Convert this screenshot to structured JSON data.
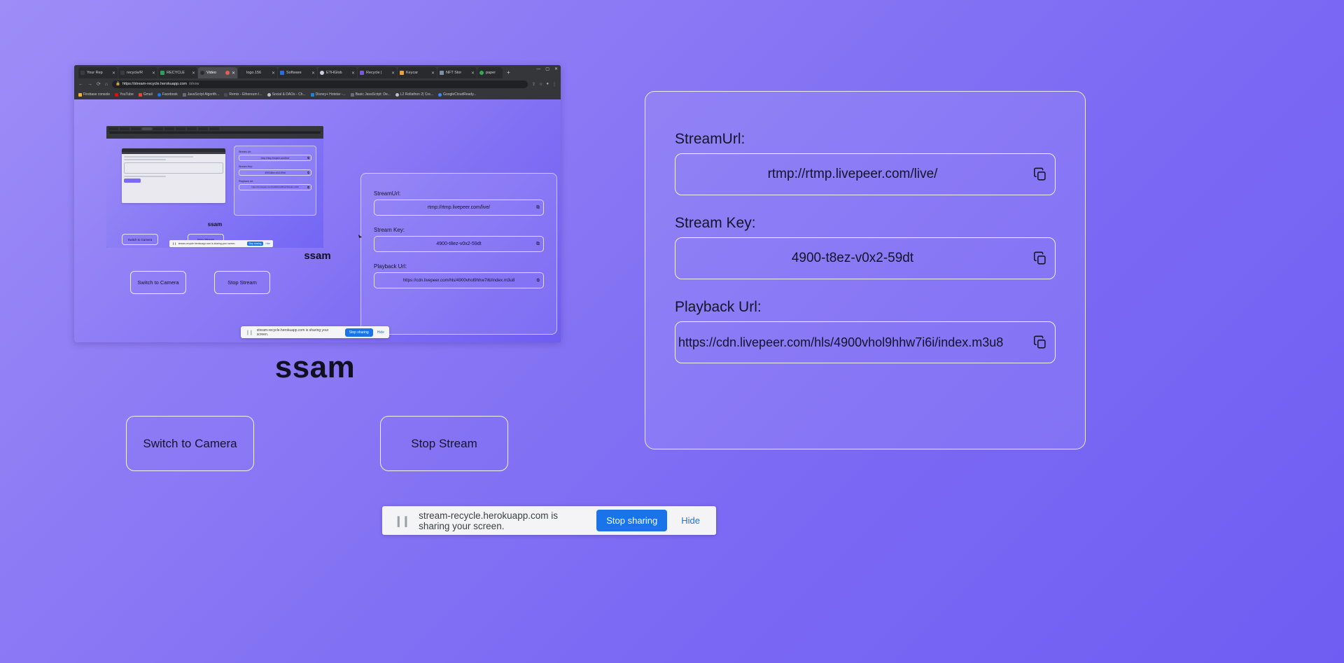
{
  "theme": {
    "background_from": "#9e8df7",
    "background_to": "#6f5df3",
    "accent_blue": "#1a73e8",
    "text_dark": "#15152a",
    "field_border": "#ffffff"
  },
  "page": {
    "title": "ssam",
    "buttons": {
      "switch_camera": "Switch to Camera",
      "stop_stream": "Stop Stream"
    }
  },
  "stream_info": {
    "stream_url_label": "StreamUrl:",
    "stream_url_value": "rtmp://rtmp.livepeer.com/live/",
    "stream_key_label": "Stream Key:",
    "stream_key_value": "4900-t8ez-v0x2-59dt",
    "playback_url_label": "Playback Url:",
    "playback_url_value": "https://cdn.livepeer.com/hls/4900vhol9hhw7i6i/index.m3u8",
    "copy_icon": "copy-icon"
  },
  "share_infobar": {
    "pause_icon": "pause-icon",
    "message": "stream-recycle.herokuapp.com is sharing your screen.",
    "stop_sharing": "Stop sharing",
    "hide": "Hide"
  },
  "screen_share_preview": {
    "browser": {
      "url_host": "https://stream-recycle.herokuapp.com",
      "url_path": "/show",
      "back_icon": "back-arrow-icon",
      "forward_icon": "forward-arrow-icon",
      "reload_icon": "reload-icon",
      "home_icon": "home-icon",
      "lock_icon": "lock-icon",
      "new_tab_icon": "plus-icon",
      "minimize_icon": "minimize-icon",
      "maximize_icon": "maximize-icon",
      "close_icon": "close-icon",
      "tabs": [
        {
          "title": "Your Rep",
          "favicon": "#3b3b44",
          "active": false
        },
        {
          "title": "recycle/R",
          "favicon": "#3b3b44",
          "active": false
        },
        {
          "title": "RECYCLE",
          "favicon": "#2f9e5c",
          "active": false
        },
        {
          "title": "Video",
          "favicon": "#2b2b33",
          "active": true
        },
        {
          "title": "logo.156",
          "favicon": "#2b2b33",
          "active": false
        },
        {
          "title": "Software",
          "favicon": "#2d6fd8",
          "active": false
        },
        {
          "title": "ETHGlob",
          "favicon": "#cfcfe0",
          "active": false
        },
        {
          "title": "Recycle |",
          "favicon": "#7a5bd6",
          "active": false
        },
        {
          "title": "Keycar",
          "favicon": "#e8a33d",
          "active": false
        },
        {
          "title": "NFT Stor",
          "favicon": "#7d8fa8",
          "active": false
        },
        {
          "title": "paper",
          "favicon": "#34a853",
          "active": false
        }
      ],
      "bookmarks": [
        {
          "label": "Firebase console",
          "favicon": "#f7b32b"
        },
        {
          "label": "YouTube",
          "favicon": "#ff0000"
        },
        {
          "label": "Gmail",
          "favicon": "#ea4335"
        },
        {
          "label": "Facebook",
          "favicon": "#1877f2"
        },
        {
          "label": "JavaScript Algorith...",
          "favicon": "#6a6a7a"
        },
        {
          "label": "Remix - Ethereum I...",
          "favicon": "#4a4a58"
        },
        {
          "label": "Social & DAOs - Ch...",
          "favicon": "#c0c0cc"
        },
        {
          "label": "Disney+ Hotstar -...",
          "favicon": "#1f80e0"
        },
        {
          "label": "Basic JavaScript: De...",
          "favicon": "#6a6a7a"
        },
        {
          "label": "L2 Rollathon 2| Cre...",
          "favicon": "#c0c0cc"
        },
        {
          "label": "GoogleCloudReady...",
          "favicon": "#4285f4"
        }
      ]
    },
    "captured_page": {
      "title": "ssam",
      "buttons": {
        "switch_camera": "Switch to Camera",
        "stop_stream": "Stop Stream"
      },
      "stream_info": {
        "stream_url_label": "StreamUrl:",
        "stream_url_value": "rtmp://rtmp.livepeer.com/live/",
        "stream_key_label": "Stream Key:",
        "stream_key_value": "4900-t8ez-v0x2-59dt",
        "playback_url_label": "Playback Url:",
        "playback_url_value": "https://cdn.livepeer.com/hls/4900vhol9hhw7i6i/index.m3u8"
      },
      "share_infobar": {
        "message": "stream-recycle.herokuapp.com is sharing your screen.",
        "stop_sharing": "Stop sharing",
        "hide": "Hide"
      },
      "nested_capture": {
        "title": "ssam",
        "buttons": {
          "switch_camera": "Switch to Camera",
          "stop_stream": "Stop Stream"
        },
        "stream_info": {
          "stream_url_label": "Stream Url:",
          "stream_url_value": "rtmp://rtmp.livepeer.com/live/",
          "stream_key_label": "Stream Key:",
          "stream_key_value": "4900-t8ez-v0x2-59dt",
          "playback_url_label": "Playback Url:",
          "playback_url_value": "https://cdn.livepeer.com/hls/4900vhol9hhw7i6i/index.m3u8"
        },
        "share_infobar": {
          "message": "stream-recycle.herokuapp.com is sharing your screen.",
          "stop_sharing": "Stop sharing",
          "hide": "Hide"
        }
      }
    }
  }
}
